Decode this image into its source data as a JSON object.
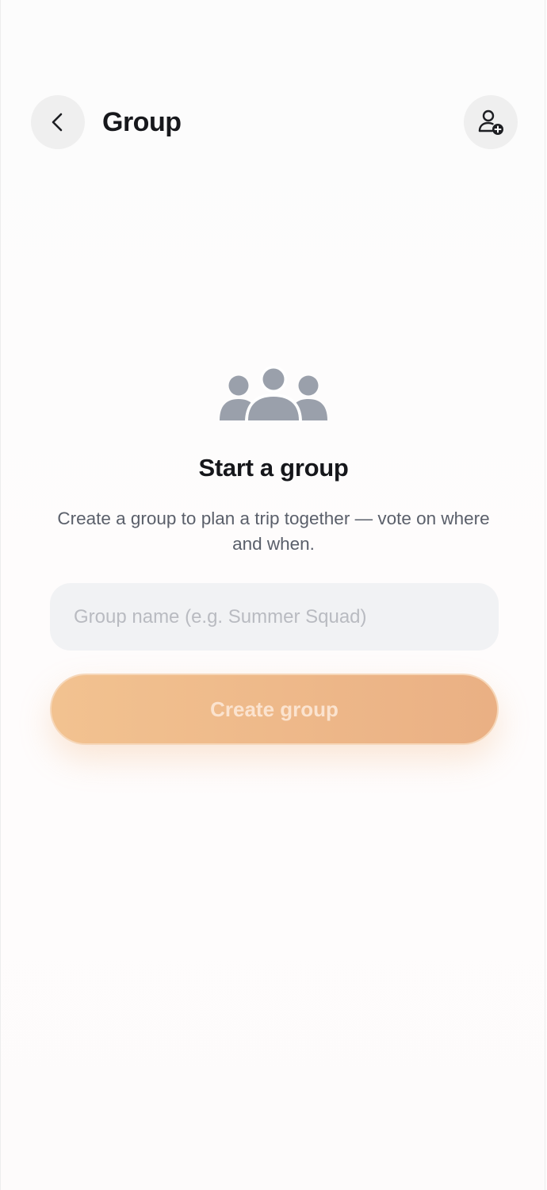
{
  "header": {
    "title": "Group",
    "back_icon": "chevron-left-icon",
    "add_member_icon": "user-plus-icon"
  },
  "empty_state": {
    "icon": "group-people-icon",
    "title": "Start a group",
    "description": "Create a group to plan a trip together — vote on where and when."
  },
  "form": {
    "group_name_value": "",
    "group_name_placeholder": "Group name (e.g. Summer Squad)",
    "create_label": "Create group"
  },
  "colors": {
    "accent_gradient_start": "#f2c290",
    "accent_gradient_end": "#eab084",
    "icon_gray": "#9aa0ab",
    "input_bg": "#f1f2f4"
  }
}
